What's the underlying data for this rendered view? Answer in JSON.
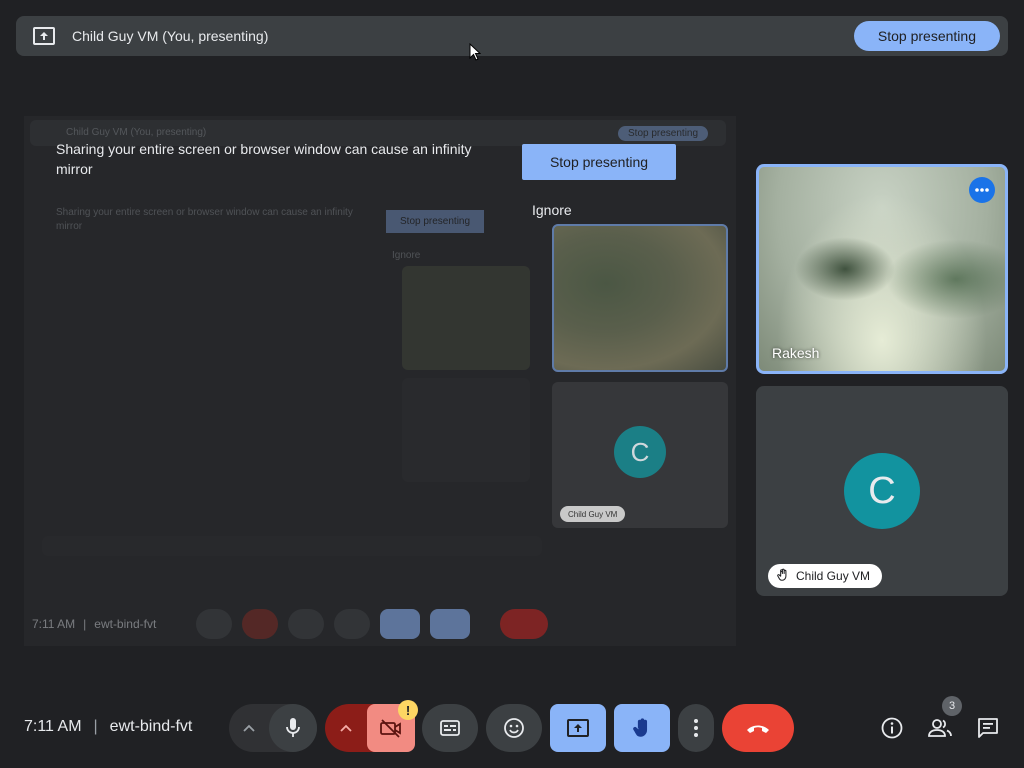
{
  "top_banner": {
    "title": "Child Guy VM (You, presenting)",
    "stop_label": "Stop presenting",
    "icon": "present-to-all-icon"
  },
  "mirror": {
    "message": "Sharing your entire screen or browser window can cause an infinity mirror",
    "stop_label": "Stop presenting",
    "ignore_label": "Ignore",
    "ghost_title": "Child Guy VM (You, presenting)",
    "ghost_stop": "Stop presenting",
    "ghost_message": "Sharing your entire screen or browser window can cause an infinity mirror",
    "ghost_ignore": "Ignore",
    "avatar_letter": "C",
    "name_chip": "Child Guy VM",
    "bottom_time": "7:11 AM",
    "bottom_code": "ewt-bind-fvt"
  },
  "participants": [
    {
      "name": "Rakesh",
      "more_icon": "more-horiz-icon"
    },
    {
      "name": "Child Guy VM",
      "avatar_letter": "C",
      "hand_icon": "raised-hand-icon"
    }
  ],
  "bottom_bar": {
    "time": "7:11 AM",
    "separator": "|",
    "meeting_code": "ewt-bind-fvt",
    "warning_glyph": "!",
    "people_count": "3"
  },
  "colors": {
    "background": "#202124",
    "accent": "#8ab4f8",
    "end_call": "#ea4335",
    "camera_off": "#f28b82",
    "avatar": "#12939f"
  }
}
